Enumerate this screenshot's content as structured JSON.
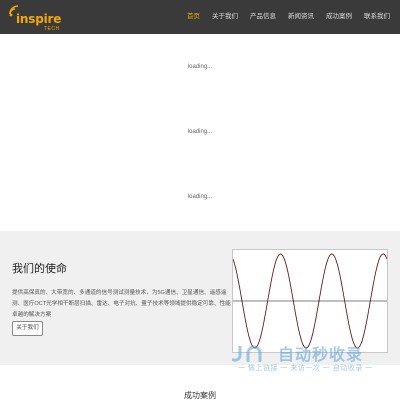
{
  "header": {
    "logo_text": "inspire",
    "logo_sub": "TECH",
    "nav": [
      {
        "label": "首页",
        "active": true
      },
      {
        "label": "关于我们",
        "active": false
      },
      {
        "label": "产品信息",
        "active": false
      },
      {
        "label": "新闻资讯",
        "active": false
      },
      {
        "label": "成功案例",
        "active": false
      },
      {
        "label": "联系我们",
        "active": false
      }
    ]
  },
  "loading": [
    "loading...",
    "loading...",
    "loading..."
  ],
  "mission": {
    "title": "我们的使命",
    "text": "提供高保真的、大带宽的、多通道的信号测试测量技术，为5G通信、卫星通信、遥感遥测、医疗OCT光学相干断层扫描、雷达、电子对抗、量子技术等领域提供稳定可靠、性能卓越的解决方案",
    "button_label": "关于我们"
  },
  "chart_data": {
    "type": "line",
    "title": "",
    "xlabel": "",
    "ylabel": "",
    "grid": false,
    "cycles": 3,
    "series": [
      {
        "style": "solid",
        "color": "#000000"
      },
      {
        "style": "dotted",
        "color": "#d03030"
      }
    ]
  },
  "watermark": {
    "text": "自动秒收录",
    "sub": "一 做上链接 一 来访一次 一 自动收录 一"
  },
  "success": {
    "title": "成功案例"
  },
  "colors": {
    "accent": "#f2a900",
    "header_bg": "#3a3a3a",
    "section_bg": "#f0f0f0"
  }
}
